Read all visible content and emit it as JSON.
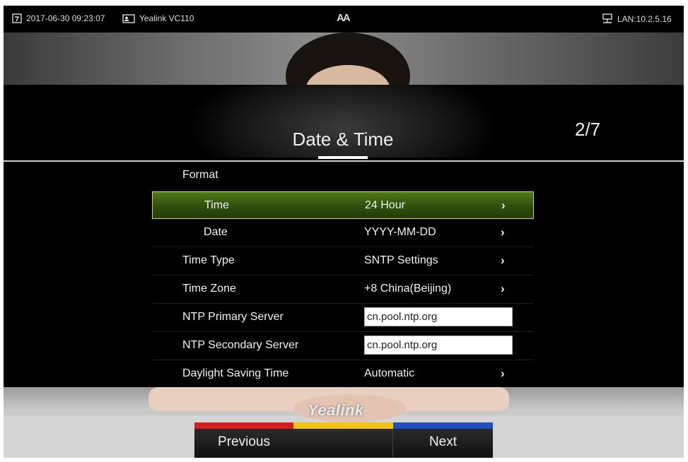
{
  "status_bar": {
    "datetime": "2017-06-30 09:23:07",
    "device_name": "Yealink VC110",
    "center_glyph": "AA",
    "network": "LAN:10.2.5.16"
  },
  "page": {
    "title": "Date & Time",
    "indicator": "2/7"
  },
  "settings": {
    "format_header": "Format",
    "rows": [
      {
        "label": "Time",
        "value": "24 Hour"
      },
      {
        "label": "Date",
        "value": "YYYY-MM-DD"
      },
      {
        "label": "Time Type",
        "value": "SNTP Settings"
      },
      {
        "label": "Time Zone",
        "value": "+8 China(Beijing)"
      },
      {
        "label": "NTP Primary Server",
        "value": "cn.pool.ntp.org"
      },
      {
        "label": "NTP Secondary Server",
        "value": "cn.pool.ntp.org"
      },
      {
        "label": "Daylight Saving Time",
        "value": "Automatic"
      }
    ],
    "arrow_glyph": "›"
  },
  "brand": "Yealink",
  "softkeys": {
    "previous": "Previous",
    "blank": "",
    "next": "Next"
  },
  "colors": {
    "selected_row": "#3d6410",
    "softkey_red": "#d81f1f",
    "softkey_yellow": "#f2c40f",
    "softkey_blue": "#1f4fbf"
  }
}
